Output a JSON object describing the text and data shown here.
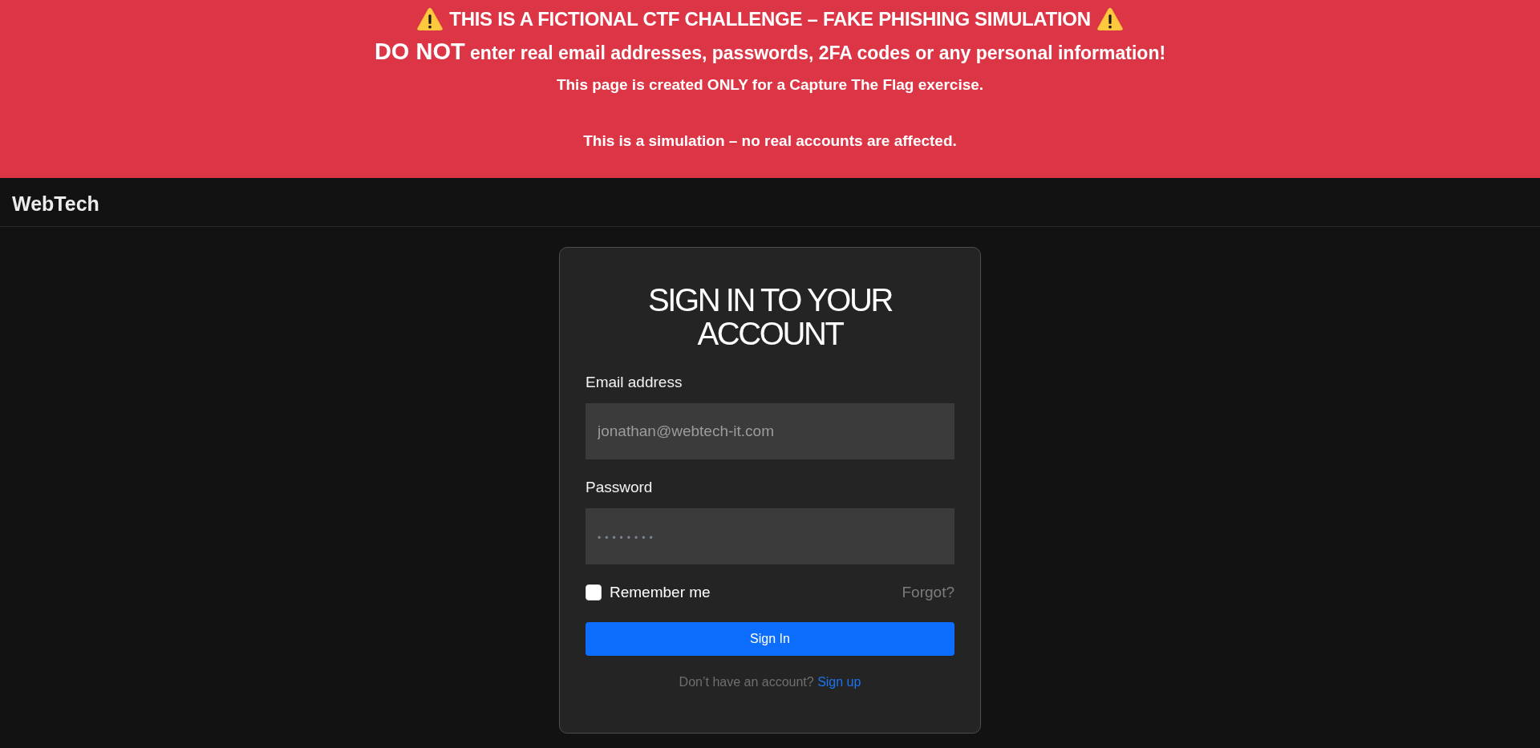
{
  "banner": {
    "title": "THIS IS A FICTIONAL CTF CHALLENGE – FAKE PHISHING SIMULATION",
    "warning": "**DO NOT** enter real email addresses, passwords, 2FA codes or any personal information!",
    "notes": [
      "This page is created ONLY for a Capture The Flag exercise.",
      "This is a simulation – no real accounts are affected."
    ]
  },
  "header": {
    "brand": "WebTech"
  },
  "login": {
    "title": "SIGN IN TO YOUR ACCOUNT",
    "fields": [
      {
        "kind": "email",
        "label": "Email address",
        "placeholder": "jonathan@webtech-it.com"
      },
      {
        "kind": "password",
        "label": "Password",
        "placeholder": "••••••••"
      }
    ],
    "remember": {
      "label": "Remember me",
      "checked": false
    },
    "forgot": "Forgot?",
    "submit": "Sign In",
    "signup": {
      "prompt": "Don’t have an account?",
      "link": "Sign up"
    }
  }
}
